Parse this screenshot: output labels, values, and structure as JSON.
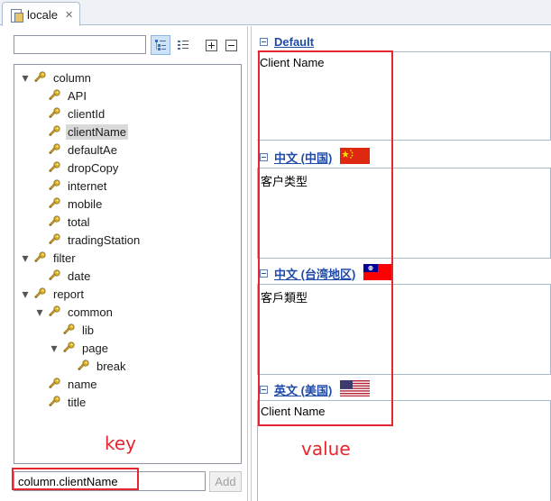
{
  "editor_tab": {
    "label": "locale",
    "icon": "properties-file-icon"
  },
  "left_pane": {
    "filter": {
      "value": "",
      "placeholder": ""
    },
    "toolbar": [
      {
        "name": "tree-view-icon",
        "active": true
      },
      {
        "name": "flat-list-icon",
        "active": false
      },
      {
        "name": "expand-all-icon",
        "active": false
      },
      {
        "name": "collapse-all-icon",
        "active": false
      }
    ],
    "tree": [
      {
        "label": "column",
        "level": 0,
        "expanded": true
      },
      {
        "label": "API",
        "level": 1
      },
      {
        "label": "clientId",
        "level": 1
      },
      {
        "label": "clientName",
        "level": 1,
        "selected": true
      },
      {
        "label": "defaultAe",
        "level": 1
      },
      {
        "label": "dropCopy",
        "level": 1
      },
      {
        "label": "internet",
        "level": 1
      },
      {
        "label": "mobile",
        "level": 1
      },
      {
        "label": "total",
        "level": 1
      },
      {
        "label": "tradingStation",
        "level": 1
      },
      {
        "label": "filter",
        "level": 0,
        "expanded": true
      },
      {
        "label": "date",
        "level": 1
      },
      {
        "label": "report",
        "level": 0,
        "expanded": true
      },
      {
        "label": "common",
        "level": 1,
        "expanded": true
      },
      {
        "label": "lib",
        "level": 2
      },
      {
        "label": "page",
        "level": 2,
        "expanded": true
      },
      {
        "label": "break",
        "level": 3
      },
      {
        "label": "name",
        "level": 1
      },
      {
        "label": "title",
        "level": 1
      }
    ],
    "key_input": {
      "value": "column.clientName"
    },
    "add_button": {
      "label": "Add",
      "enabled": false
    }
  },
  "right_pane": {
    "sections": [
      {
        "title": "Default",
        "flag": null,
        "value": "Client Name"
      },
      {
        "title": "中文 (中国)",
        "flag": "china-flag-icon",
        "value": "客户类型"
      },
      {
        "title": "中文 (台湾地区)",
        "flag": "taiwan-flag-icon",
        "value": "客戶類型"
      },
      {
        "title": "英文 (美国)",
        "flag": "usa-flag-icon",
        "value": "Client Name"
      }
    ]
  },
  "annotations": {
    "key_label": "key",
    "value_label": "value",
    "color": "#e8262e"
  },
  "colors": {
    "link_blue": "#1f4aa8",
    "selection": "#d9d9d9",
    "toolbar_active": "#cfe3f8"
  }
}
